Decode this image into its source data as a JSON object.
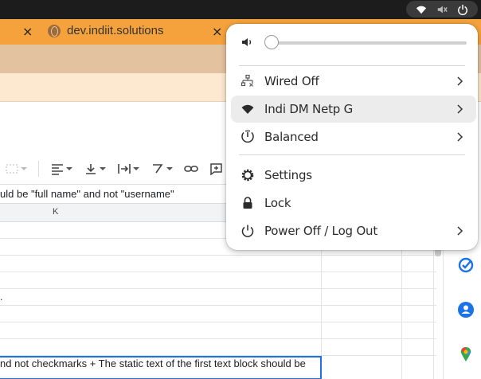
{
  "browser": {
    "tab_close_glyph": "×",
    "tab_title": "dev.indiit.solutions"
  },
  "sheet": {
    "formula_text": "uld be \"full name\" and not \"username\"",
    "column_label": "K",
    "row_fragment": ".",
    "active_cell_text": "nd not checkmarks + The static text of the first text block should be"
  },
  "quick_settings": {
    "volume_level": 0.0,
    "items": [
      {
        "label": "Wired Off",
        "icon": "wired-network-icon",
        "has_submenu": true
      },
      {
        "label": "Indi DM Netp G",
        "icon": "wifi-icon",
        "has_submenu": true,
        "highlighted": true
      },
      {
        "label": "Balanced",
        "icon": "power-profile-icon",
        "has_submenu": true
      },
      {
        "label": "Settings",
        "icon": "gear-icon",
        "has_submenu": false
      },
      {
        "label": "Lock",
        "icon": "lock-icon",
        "has_submenu": false
      },
      {
        "label": "Power Off / Log Out",
        "icon": "power-icon",
        "has_submenu": true
      }
    ]
  },
  "colors": {
    "tab_accent": "#f5a23c",
    "selection_blue": "#1a73e8",
    "topbar": "#1c1c1c"
  }
}
